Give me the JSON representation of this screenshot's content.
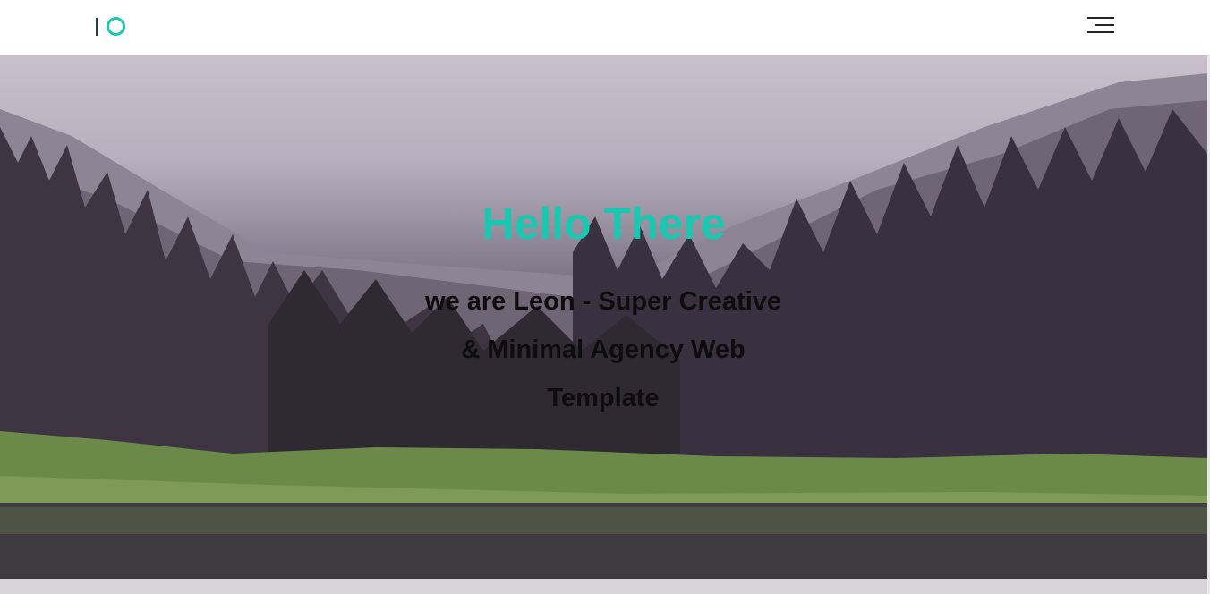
{
  "header": {
    "logo_alt": "IO"
  },
  "hero": {
    "title": "Hello There",
    "subtitle": "we are Leon - Super Creative & Minimal Agency Web Template"
  },
  "colors": {
    "accent": "#1ac7b0",
    "logo_dark": "#2b3a40",
    "text_dark": "#0d0d0d"
  },
  "icons": {
    "menu": "hamburger-icon",
    "logo": "logo-mark-icon"
  }
}
